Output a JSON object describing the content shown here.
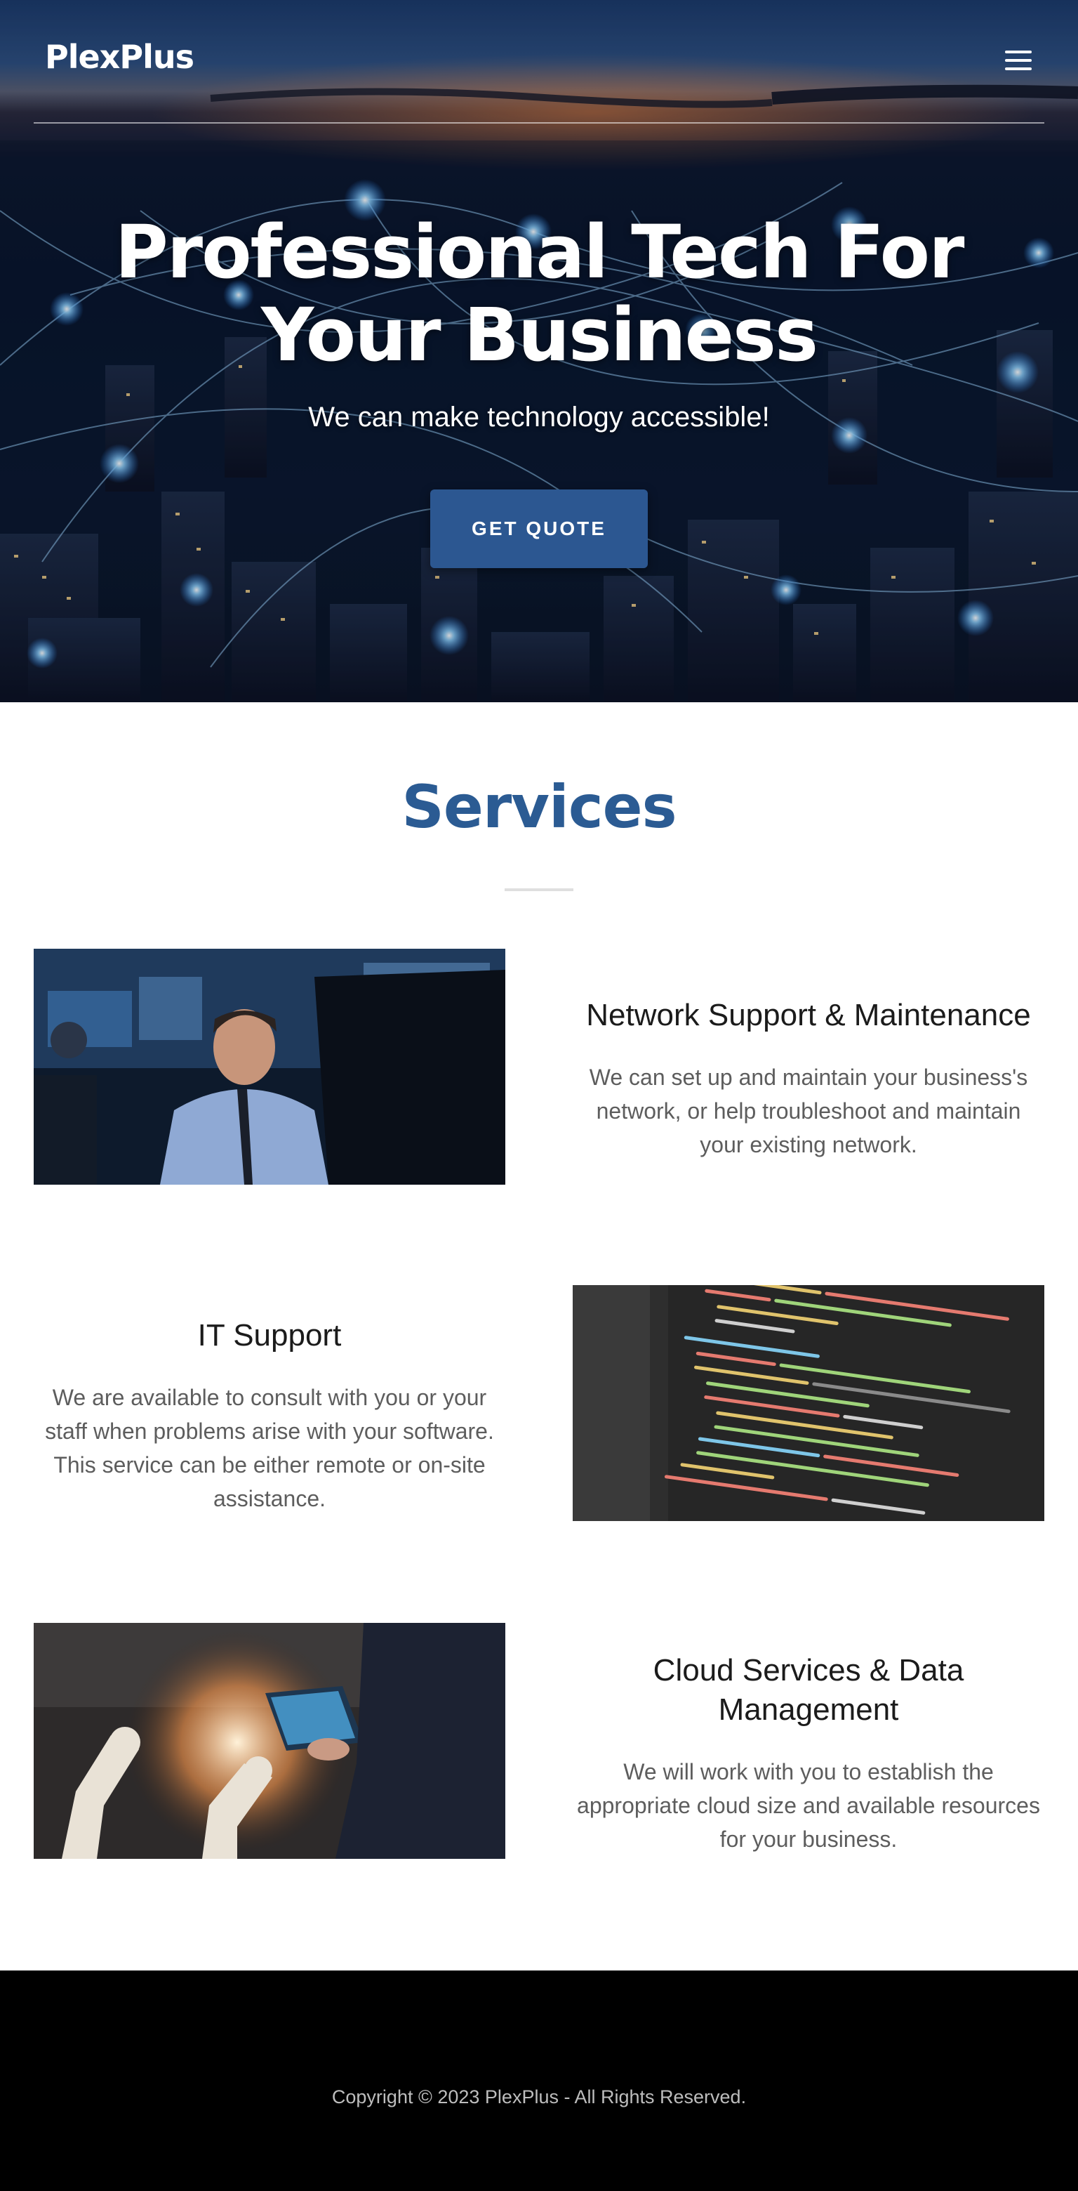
{
  "header": {
    "logo": "PlexPlus",
    "menu_icon": "hamburger-menu-icon"
  },
  "hero": {
    "title": "Professional Tech For Your Business",
    "subtitle": "We can make technology accessible!",
    "cta_label": "GET QUOTE"
  },
  "services": {
    "title": "Services",
    "items": [
      {
        "heading": "Network Support & Maintenance",
        "body": "We can set up and maintain your business's network, or help troubleshoot and maintain your existing network."
      },
      {
        "heading": "IT Support",
        "body": "We are available to consult with you or your staff when problems arise with your software. This service can be either remote or on-site assistance."
      },
      {
        "heading": "Cloud Services & Data Management",
        "body": "We will work with you to establish the appropriate cloud size and available resources for your business."
      }
    ]
  },
  "footer": {
    "copyright": "Copyright © 2023 PlexPlus - All Rights Reserved."
  },
  "colors": {
    "accent": "#2b5b93",
    "button": "#2c5791",
    "footer_bg": "#000000"
  }
}
